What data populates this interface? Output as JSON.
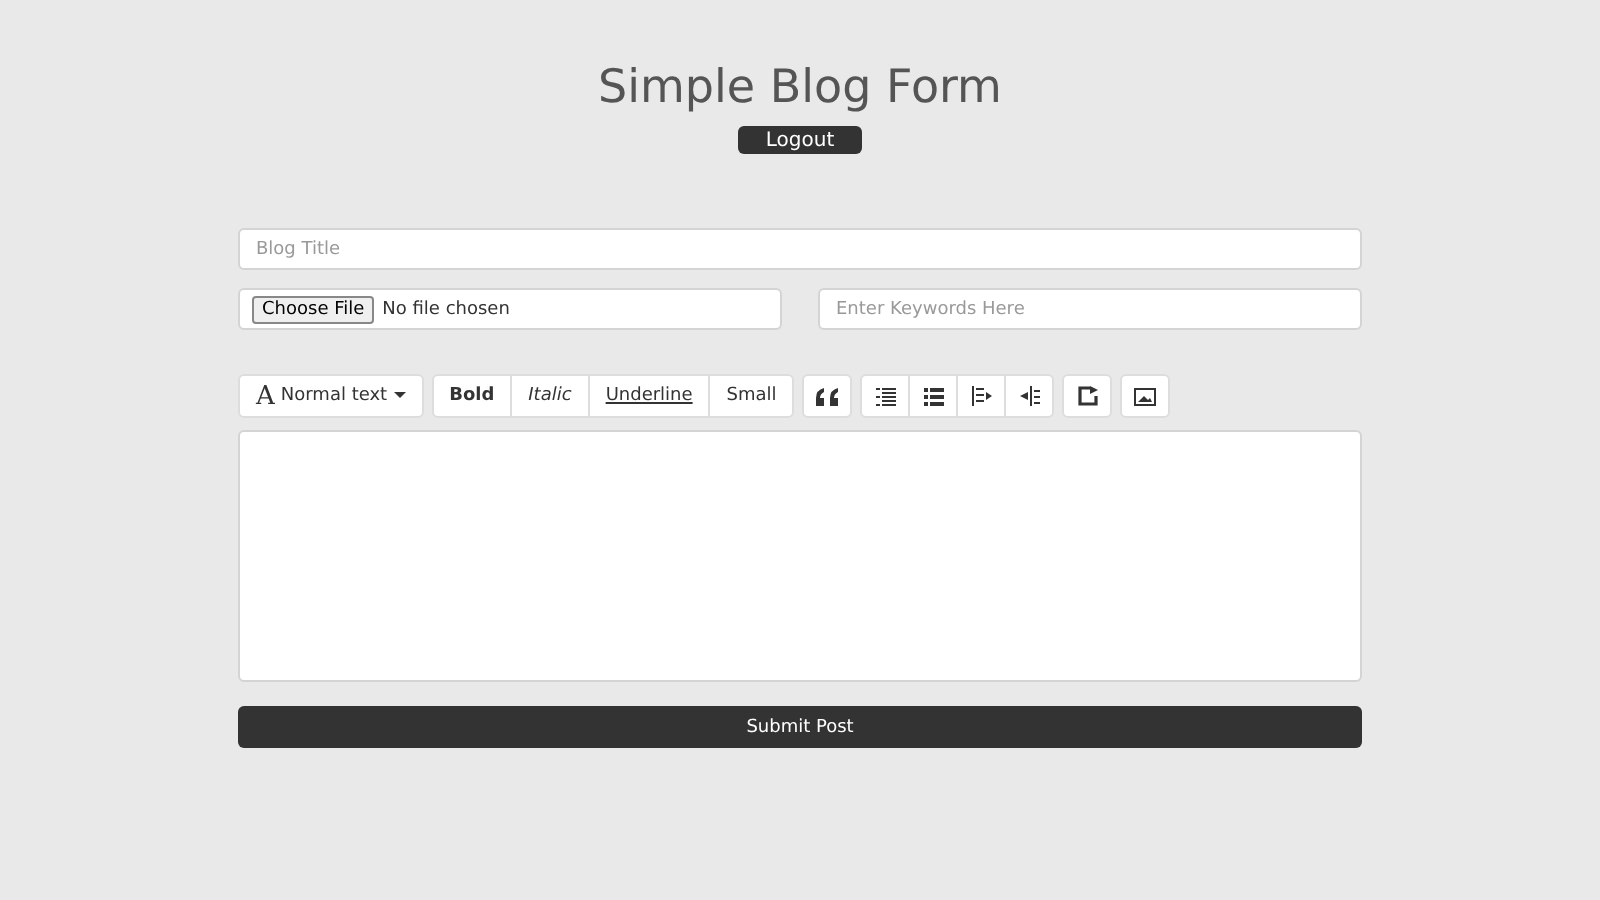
{
  "header": {
    "title": "Simple Blog Form",
    "logout": "Logout"
  },
  "title_field": {
    "placeholder": "Blog Title"
  },
  "file_field": {
    "button": "Choose File",
    "status": "No file chosen"
  },
  "keywords_field": {
    "placeholder": "Enter Keywords Here"
  },
  "toolbar": {
    "font_icon": "A",
    "font_menu": "Normal text",
    "formats": [
      {
        "label": "Bold",
        "kind": "bold"
      },
      {
        "label": "Italic",
        "kind": "italic"
      },
      {
        "label": "Underline",
        "kind": "underline"
      },
      {
        "label": "Small",
        "kind": "small"
      }
    ],
    "icon_groups": [
      [
        {
          "kind": "quote"
        }
      ],
      [
        {
          "kind": "bullet-list"
        },
        {
          "kind": "numbered-list"
        },
        {
          "kind": "outdent"
        },
        {
          "kind": "indent"
        }
      ],
      [
        {
          "kind": "redo"
        }
      ],
      [
        {
          "kind": "image"
        }
      ]
    ]
  },
  "submit": "Submit Post"
}
